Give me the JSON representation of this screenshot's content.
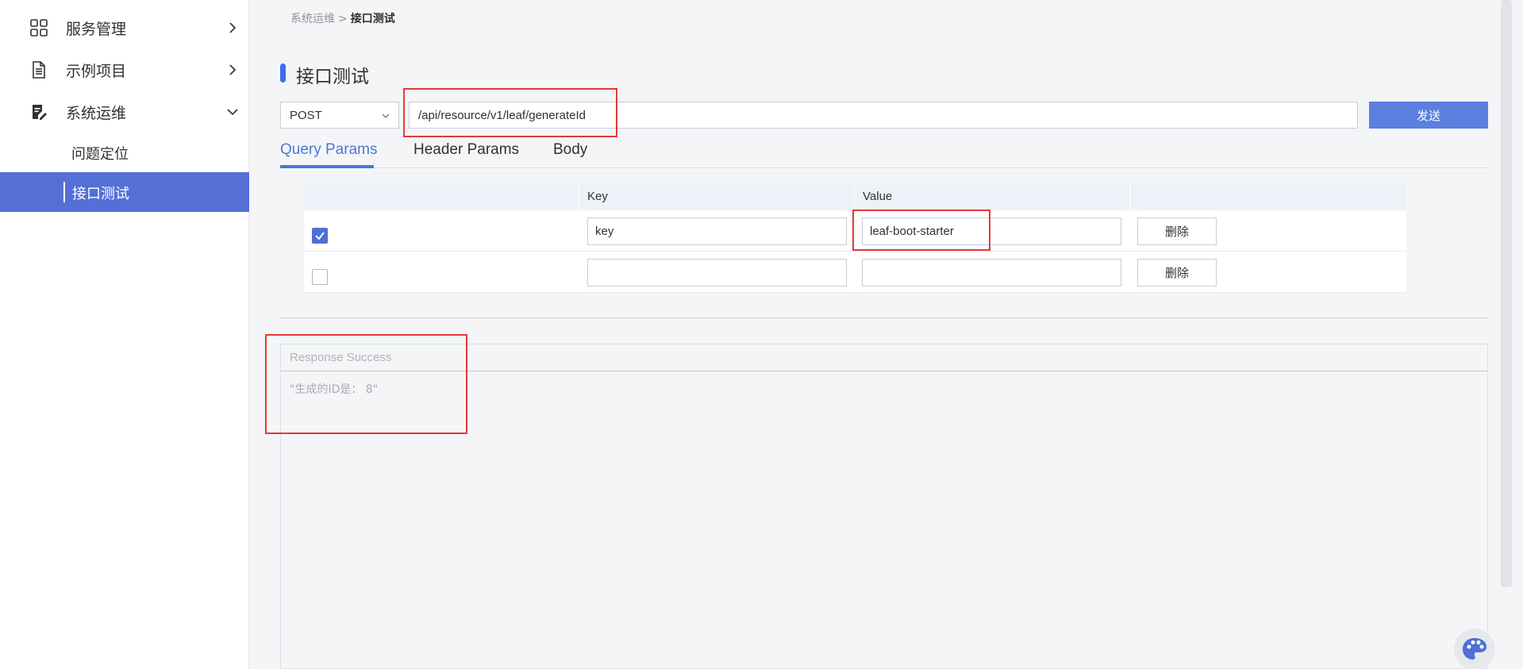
{
  "sidebar": {
    "items": [
      {
        "label": "服务管理",
        "icon": "grid-icon",
        "expanded": false
      },
      {
        "label": "示例项目",
        "icon": "document-icon",
        "expanded": false
      },
      {
        "label": "系统运维",
        "icon": "clipboard-edit-icon",
        "expanded": true
      }
    ],
    "sub_items": [
      {
        "label": "问题定位",
        "active": false
      },
      {
        "label": "接口测试",
        "active": true
      }
    ]
  },
  "breadcrumb": {
    "parent": "系统运维",
    "separator": ">",
    "current": "接口测试"
  },
  "page_title": "接口测试",
  "request": {
    "method": "POST",
    "url": "/api/resource/v1/leaf/generateId",
    "send_label": "发送"
  },
  "tabs": [
    {
      "label": "Query Params",
      "active": true
    },
    {
      "label": "Header Params",
      "active": false
    },
    {
      "label": "Body",
      "active": false
    }
  ],
  "params_table": {
    "headers": [
      "",
      "Key",
      "Value",
      ""
    ],
    "rows": [
      {
        "checked": true,
        "key": "key",
        "value": "leaf-boot-starter",
        "delete_label": "删除"
      },
      {
        "checked": false,
        "key": "",
        "value": "",
        "delete_label": "删除"
      }
    ]
  },
  "response": {
    "status": "Response Success",
    "body": "\"生成的ID是： 8\""
  },
  "colors": {
    "accent": "#5470d6",
    "send_button": "#5b7fde",
    "active_tab": "#4a78d8",
    "highlight_box": "#e53935"
  }
}
